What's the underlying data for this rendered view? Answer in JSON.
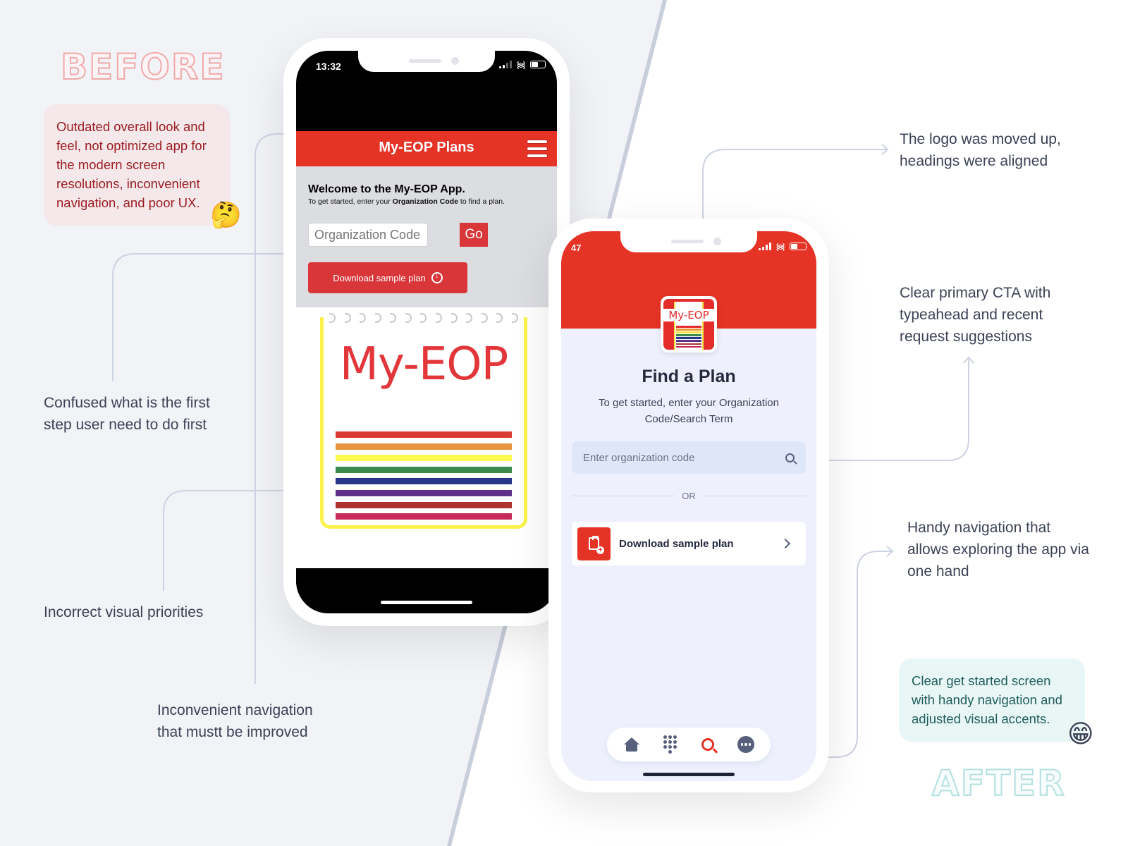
{
  "labels": {
    "before": "BEFORE",
    "after": "AFTER"
  },
  "before_notes": {
    "callout": "Outdated overall look and feel, not optimized app for the modern screen resolutions, inconvenient navigation, and poor UX.",
    "callout_emoji": "🤔",
    "first_step": "Confused what is the first step user need to do first",
    "visual_priorities": "Incorrect visual priorities",
    "navigation": "Inconvenient navigation that mustt be improved"
  },
  "after_notes": {
    "logo": "The logo was moved up, headings were aligned",
    "cta": "Clear primary CTA with typeahead and recent request suggestions",
    "navigation": "Handy navigation that allows exploring the app via one hand",
    "callout": "Clear get started screen with handy navigation and adjusted visual accents.",
    "callout_emoji": "😁"
  },
  "old_app": {
    "status_time": "13:32",
    "header_title": "My-EOP Plans",
    "menu_icon": "hamburger-icon",
    "welcome": "Welcome to the My-EOP App.",
    "sub_prefix": "To get started, enter your ",
    "sub_bold": "Organization Code",
    "sub_suffix": " to find a plan.",
    "input_placeholder": "Organization Code",
    "go_label": "Go",
    "download_label": "Download sample plan",
    "download_icon": "download-circle-icon",
    "logo_text": "My-EOP",
    "stripe_colors": [
      "#d93a33",
      "#e9953e",
      "#fdf94e",
      "#3b8a4b",
      "#263688",
      "#5e3189",
      "#ad3230",
      "#c52b58"
    ]
  },
  "new_app": {
    "status_time": "47",
    "logo_text": "My-EOP",
    "logo_stripe_colors": [
      "#e42c2a",
      "#e9953e",
      "#f6e34a",
      "#3b8a4b",
      "#263688",
      "#5e3189",
      "#ad3230",
      "#c52b58"
    ],
    "title": "Find a Plan",
    "subtitle": "To get started, enter your Organization Code/Search Term",
    "search_placeholder": "Enter organization code",
    "search_icon": "search-icon",
    "or_label": "OR",
    "download_label": "Download sample plan",
    "download_icon": "clipboard-add-icon",
    "tabs": [
      {
        "name": "home",
        "icon": "home-icon",
        "active": false
      },
      {
        "name": "dialpad",
        "icon": "dialpad-icon",
        "active": false
      },
      {
        "name": "search",
        "icon": "search-icon",
        "active": true
      },
      {
        "name": "more",
        "icon": "more-icon",
        "active": false
      }
    ]
  },
  "colors": {
    "brand_red": "#e53326",
    "before_callout_text": "#9c1d22",
    "after_callout_text": "#1f5d5c",
    "tab_icon": "#56607b"
  }
}
